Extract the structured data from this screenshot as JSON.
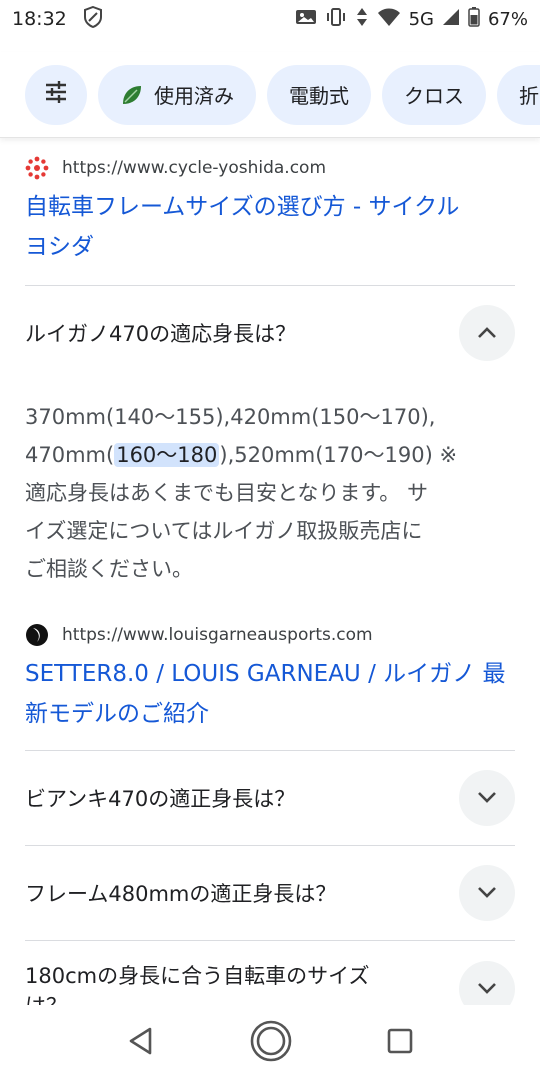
{
  "status": {
    "time": "18:32",
    "network": "5G",
    "battery": "67%"
  },
  "chips": [
    {
      "label": "",
      "icon": "tune-icon"
    },
    {
      "label": "使用済み",
      "icon": "leaf-icon"
    },
    {
      "label": "電動式"
    },
    {
      "label": "クロス"
    },
    {
      "label": "折り"
    }
  ],
  "results": [
    {
      "url": "https://www.cycle-yoshida.com",
      "title_line1": "自転車フレームサイズの選び方 - サイクル",
      "title_line2": "ヨシダ"
    },
    {
      "url": "https://www.louisgarneausports.com",
      "title_line1": "SETTER8.0 / LOUIS GARNEAU / ルイガノ 最",
      "title_line2": "新モデルのご紹介"
    }
  ],
  "faq": {
    "q1": "ルイガノ470の適応身長は？",
    "answer_line1": "370mm(140〜155),420mm(150〜170),",
    "answer_line2_pre": "470mm(",
    "answer_line2_hl": "160〜180",
    "answer_line2_post": "),520mm(170〜190) ※",
    "answer_line3": "適応身長はあくまでも目安となります。 サ",
    "answer_line4": "イズ選定についてはルイガノ取扱販売店に",
    "answer_line5": "ご相談ください。",
    "q2": "ビアンキ470の適正身長は？",
    "q3": "フレーム480mmの適正身長は？",
    "q4_line1": "180cmの身長に合う自転車のサイズ",
    "q4_line2": "は？"
  }
}
